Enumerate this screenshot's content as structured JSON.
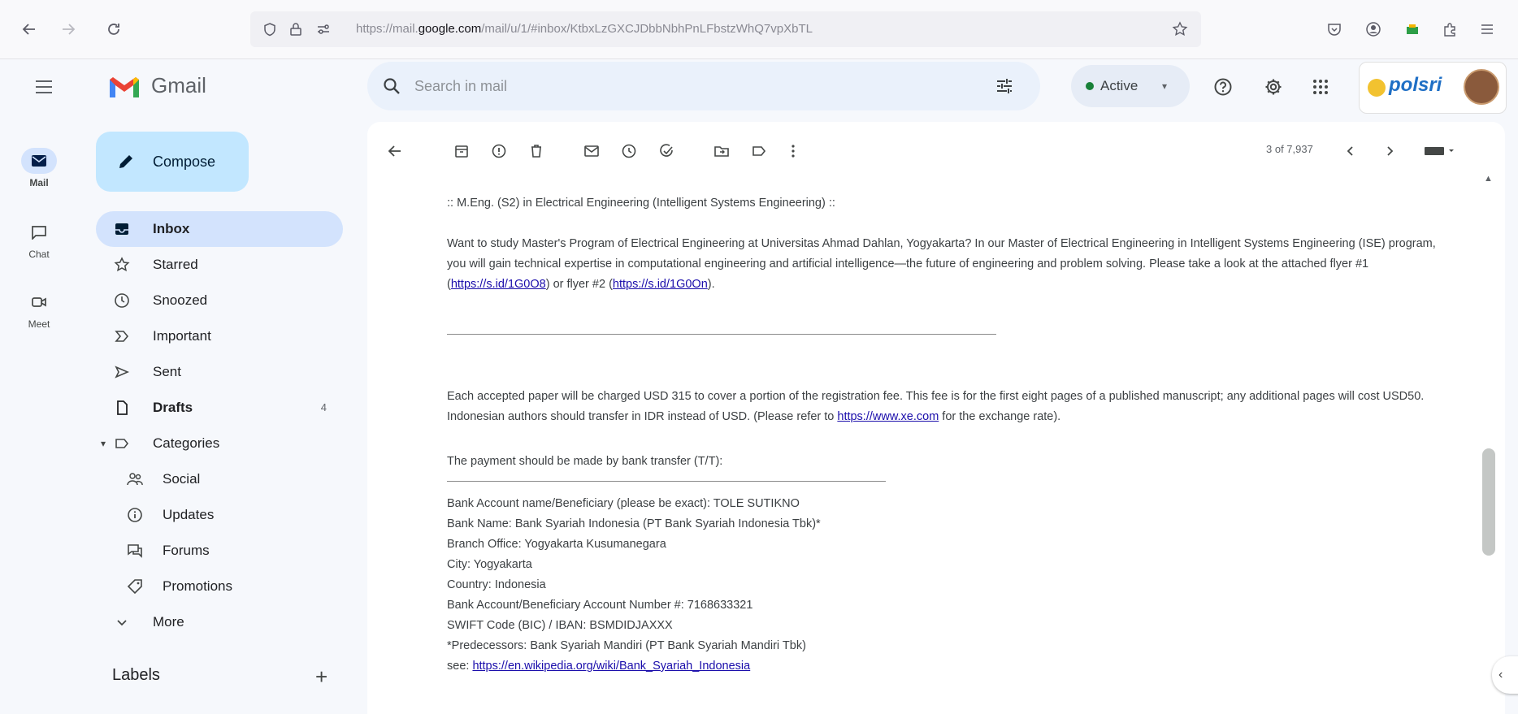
{
  "browser": {
    "url_prefix": "https://mail.",
    "url_domain": "google.com",
    "url_path": "/mail/u/1/#inbox/KtbxLzGXCJDbbNbhPnLFbstzWhQ7vpXbTL"
  },
  "app": {
    "name": "Gmail"
  },
  "search": {
    "placeholder": "Search in mail"
  },
  "status": {
    "label": "Active"
  },
  "account": {
    "brand": "polsri"
  },
  "rail": [
    {
      "label": "Mail"
    },
    {
      "label": "Chat"
    },
    {
      "label": "Meet"
    }
  ],
  "compose": {
    "label": "Compose"
  },
  "nav": [
    {
      "label": "Inbox",
      "count": ""
    },
    {
      "label": "Starred",
      "count": ""
    },
    {
      "label": "Snoozed",
      "count": ""
    },
    {
      "label": "Important",
      "count": ""
    },
    {
      "label": "Sent",
      "count": ""
    },
    {
      "label": "Drafts",
      "count": "4"
    },
    {
      "label": "Categories",
      "count": ""
    },
    {
      "label": "Social",
      "count": ""
    },
    {
      "label": "Updates",
      "count": ""
    },
    {
      "label": "Forums",
      "count": ""
    },
    {
      "label": "Promotions",
      "count": ""
    },
    {
      "label": "More",
      "count": ""
    }
  ],
  "labels": {
    "heading": "Labels"
  },
  "pager": {
    "text": "3 of 7,937"
  },
  "email": {
    "program_title": ":: M.Eng. (S2) in Electrical Engineering (Intelligent Systems Engineering) ::",
    "intro": "Want to study Master's Program of Electrical Engineering at Universitas Ahmad Dahlan, Yogyakarta? In our Master of Electrical Engineering in Intelligent Systems Engineering (ISE) program, you will gain technical expertise in computational engineering and artificial intelligence—the future of engineering and problem solving. Please take a look at the attached flyer #1 (",
    "flyer1_link": "https://s.id/1G0O8",
    "intro_mid": ") or flyer #2 (",
    "flyer2_link": "https://s.id/1G0On",
    "intro_end": ").",
    "fee_text": "Each accepted paper will be charged USD 315 to cover a portion of the registration fee. This fee is for the first eight pages of a published manuscript; any additional pages will cost USD50. Indonesian authors should transfer in IDR instead of USD. (Please refer to ",
    "fee_link": "https://www.xe.com",
    "fee_end": " for the exchange rate).",
    "payment_heading": "The payment should be made by bank transfer (T/T):",
    "bank_lines": [
      "Bank Account name/Beneficiary (please be exact): TOLE SUTIKNO",
      "Bank Name: Bank Syariah Indonesia (PT Bank Syariah Indonesia Tbk)*",
      "Branch Office: Yogyakarta Kusumanegara",
      "City: Yogyakarta",
      "Country: Indonesia",
      "Bank Account/Beneficiary Account Number #: 7168633321",
      "SWIFT Code (BIC) / IBAN: BSMDIDJAXXX",
      "*Predecessors: Bank Syariah Mandiri (PT Bank Syariah Mandiri Tbk)"
    ],
    "see_prefix": "see: ",
    "see_link": "https://en.wikipedia.org/wiki/Bank_Syariah_Indonesia"
  },
  "colors": {
    "compose_bg": "#c2e7ff",
    "selected_nav_bg": "#d3e3fd",
    "active_dot": "#188038",
    "link": "#1a0dab"
  }
}
